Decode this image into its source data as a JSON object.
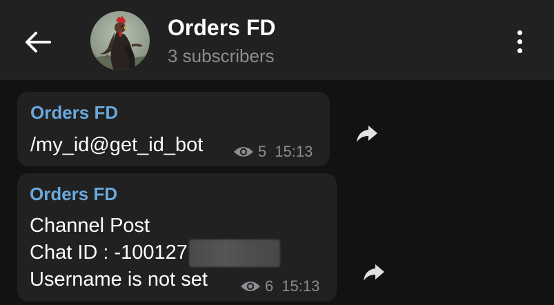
{
  "header": {
    "title": "Orders FD",
    "subtitle": "3 subscribers",
    "back_icon": "arrow-left-icon",
    "menu_icon": "more-vertical-icon"
  },
  "colors": {
    "header_bg": "#212121",
    "chat_bg": "#121212",
    "bubble_bg": "#212121",
    "sender_name": "#6aa9de",
    "meta_text": "#8a8d91"
  },
  "messages": [
    {
      "sender": "Orders FD",
      "lines": [
        "/my_id@get_id_bot"
      ],
      "views": "5",
      "time": "15:13",
      "share_icon": "share-arrow-icon"
    },
    {
      "sender": "Orders FD",
      "lines": [
        "Channel Post",
        "Chat ID : -100127",
        "Username is not set"
      ],
      "views": "6",
      "time": "15:13",
      "share_icon": "share-arrow-icon"
    }
  ]
}
